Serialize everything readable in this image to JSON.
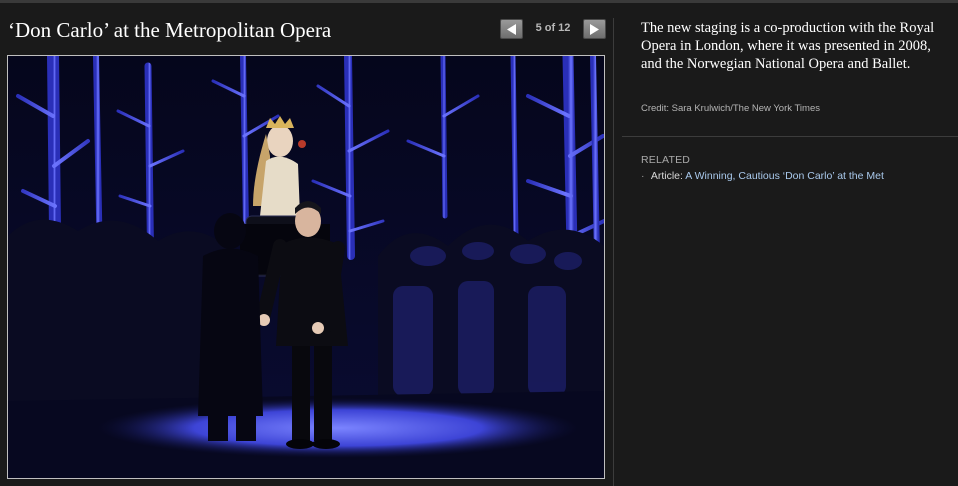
{
  "slideshow": {
    "title": "‘Don Carlo’ at the Metropolitan Opera",
    "counter": "5 of 12",
    "prev_icon": "triangle-left-icon",
    "next_icon": "triangle-right-icon"
  },
  "caption": {
    "text": "The new staging is a co-production with the Royal Opera in London, where it was presented in 2008, and the Norwegian National Opera and Ballet.",
    "credit": "Credit: Sara Krulwich/The New York Times"
  },
  "related": {
    "heading": "RELATED",
    "items": [
      {
        "bullet": "·",
        "prefix": "Article:",
        "link": "A Winning, Cautious ‘Don Carlo’ at the Met"
      }
    ]
  },
  "colors": {
    "background": "#1a1a1a",
    "link": "#a9c9ec",
    "stage_light": "#5a63ff"
  }
}
